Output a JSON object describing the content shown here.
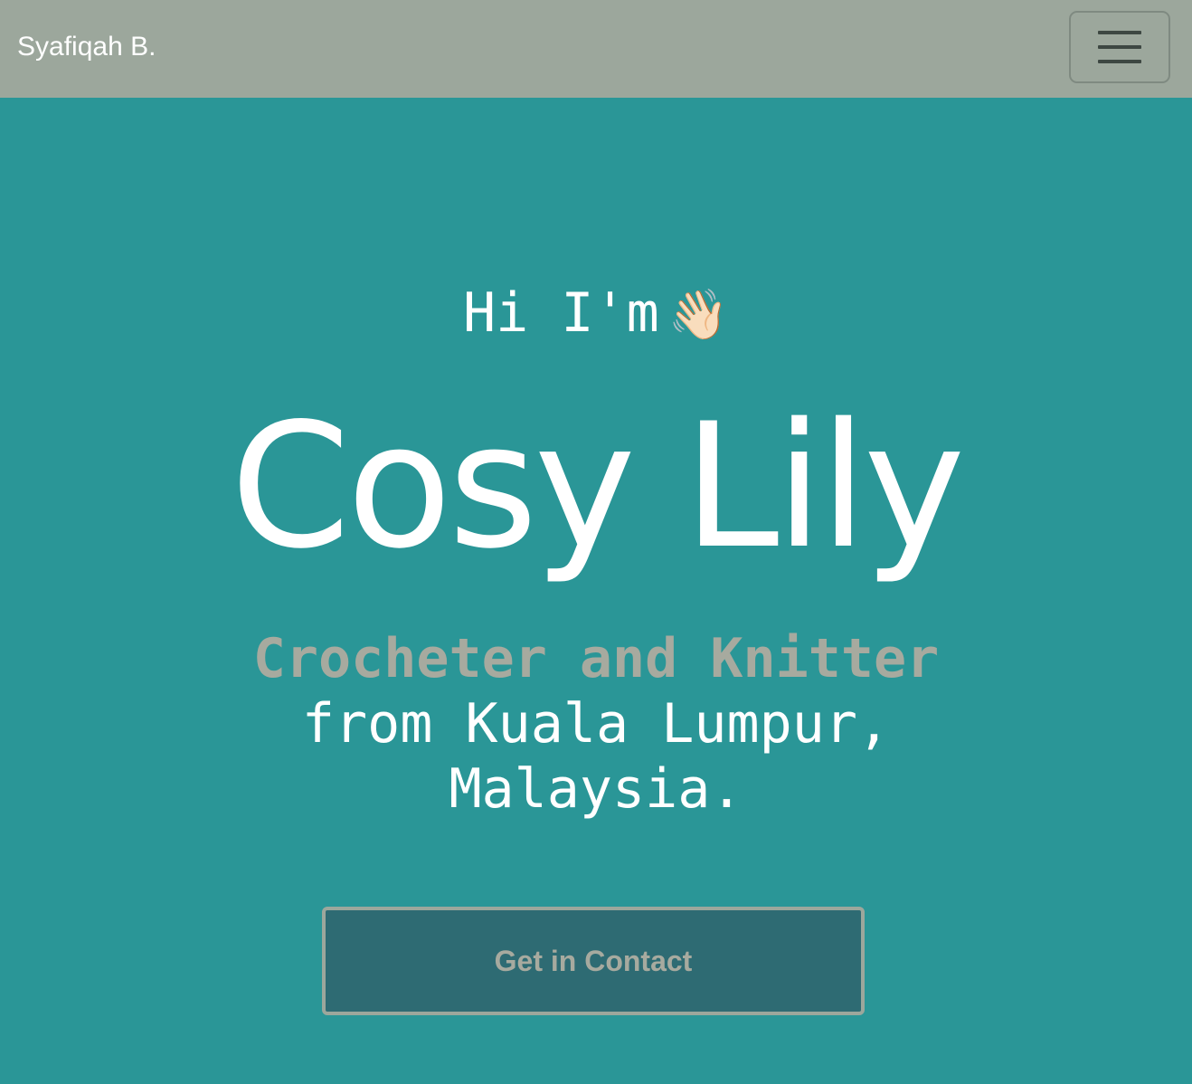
{
  "navbar": {
    "brand": "Syafiqah B.",
    "toggler_icon": "hamburger-menu-icon",
    "background_color": "#9ca79c"
  },
  "hero": {
    "greeting": "Hi I'm",
    "greeting_emoji": "👋🏻",
    "title": "Cosy Lily",
    "role": "Crocheter and Knitter",
    "location": "from Kuala Lumpur, Malaysia.",
    "cta_label": "Get in Contact",
    "background_color": "#2a9697",
    "accent_color": "#a7aa9f",
    "button_color": "#2e6b73"
  }
}
